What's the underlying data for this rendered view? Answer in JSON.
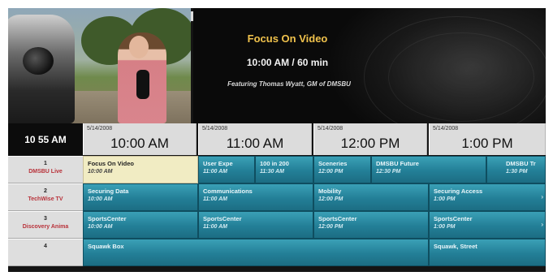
{
  "now_playing": {
    "title": "Focus On Video",
    "time": "10:00 AM / 60 min",
    "description": "Featuring Thomas Wyatt, GM of DMSBU"
  },
  "clock": "10 55 AM",
  "timeslots": [
    {
      "date": "5/14/2008",
      "time": "10:00 AM"
    },
    {
      "date": "5/14/2008",
      "time": "11:00 AM"
    },
    {
      "date": "5/14/2008",
      "time": "12:00 PM"
    },
    {
      "date": "5/14/2008",
      "time": "1:00 PM"
    }
  ],
  "channels": [
    {
      "number": "1",
      "name": "DMSBU Live",
      "programs": [
        {
          "title": "Focus On Video",
          "start": "10:00 AM"
        },
        {
          "title": "User Expe",
          "start": "11:00 AM"
        },
        {
          "title": "100 in 200",
          "start": "11:30 AM"
        },
        {
          "title": "Sceneries",
          "start": "12:00 PM"
        },
        {
          "title": "DMSBU Future",
          "start": "12:30 PM"
        },
        {
          "title": "DMSBU Tr",
          "start": "1:30 PM"
        }
      ]
    },
    {
      "number": "2",
      "name": "TechWise TV",
      "programs": [
        {
          "title": "Securing Data",
          "start": "10:00 AM"
        },
        {
          "title": "Communications",
          "start": "11:00 AM"
        },
        {
          "title": "Mobility",
          "start": "12:00 PM"
        },
        {
          "title": "Securing Access",
          "start": "1:00 PM"
        }
      ]
    },
    {
      "number": "3",
      "name": "Discovery Anima",
      "programs": [
        {
          "title": "SportsCenter",
          "start": "10:00 AM"
        },
        {
          "title": "SportsCenter",
          "start": "11:00 AM"
        },
        {
          "title": "SportsCenter",
          "start": "12:00 PM"
        },
        {
          "title": "SportsCenter",
          "start": "1:00 PM"
        }
      ]
    },
    {
      "number": "4",
      "name": "",
      "programs": [
        {
          "title": "Squawk Box",
          "start": ""
        },
        {
          "title": "Squawk, Street",
          "start": ""
        }
      ]
    }
  ]
}
